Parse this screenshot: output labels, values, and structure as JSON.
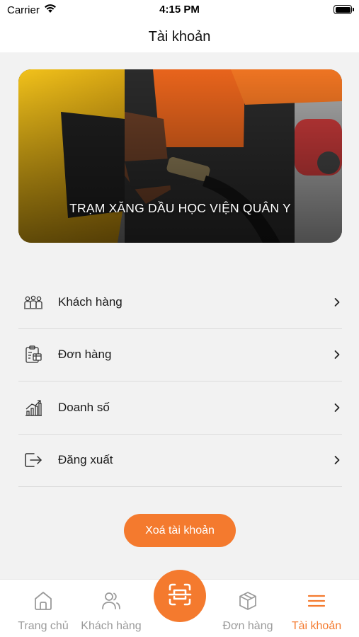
{
  "status_bar": {
    "carrier": "Carrier",
    "time": "4:15 PM"
  },
  "nav": {
    "title": "Tài khoản"
  },
  "hero": {
    "title": "TRẠM XĂNG DẦU HỌC VIỆN QUÂN Y"
  },
  "menu": {
    "items": [
      {
        "label": "Khách hàng",
        "icon": "customers-icon"
      },
      {
        "label": "Đơn hàng",
        "icon": "orders-clipboard-icon"
      },
      {
        "label": "Doanh số",
        "icon": "sales-chart-icon"
      },
      {
        "label": "Đăng xuất",
        "icon": "logout-icon"
      }
    ]
  },
  "delete_account": {
    "label": "Xoá tài khoản"
  },
  "tab_bar": {
    "tabs": [
      {
        "label": "Trang chủ",
        "icon": "home-icon"
      },
      {
        "label": "Khách hàng",
        "icon": "users-icon"
      },
      {
        "label": "",
        "icon": "scan-icon"
      },
      {
        "label": "Đơn hàng",
        "icon": "box-icon"
      },
      {
        "label": "Tài khoản",
        "icon": "menu-icon"
      }
    ],
    "active": "Tài khoản"
  },
  "colors": {
    "accent": "#f47a2e",
    "inactive": "#9a9a9a",
    "background": "#f2f2f2"
  }
}
